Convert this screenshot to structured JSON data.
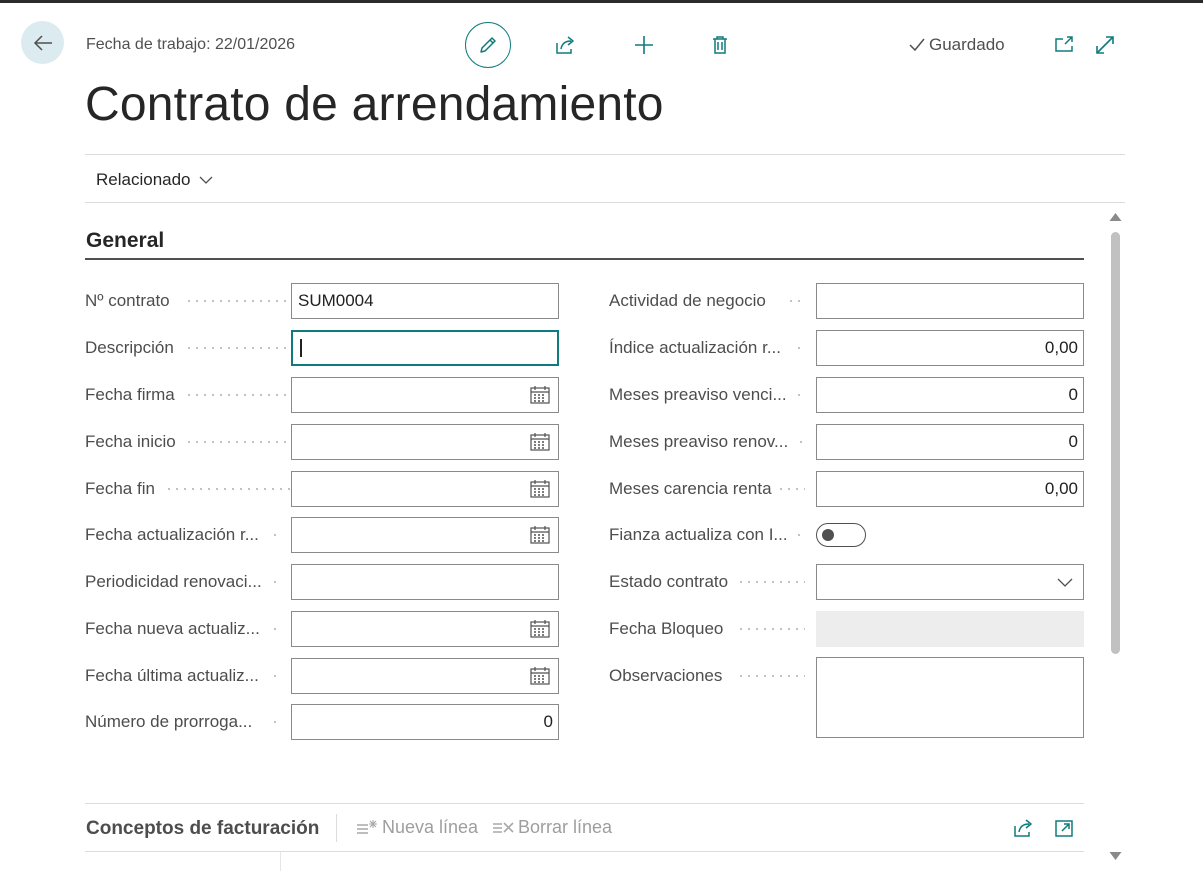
{
  "header": {
    "work_date": "Fecha de trabajo: 22/01/2026",
    "status": "Guardado",
    "title": "Contrato de arrendamiento",
    "related": "Relacionado",
    "icons": [
      "back-arrow-icon",
      "pencil-icon",
      "share-icon",
      "plus-icon",
      "trash-icon",
      "checkmark-icon",
      "popout-icon",
      "expand-icon"
    ]
  },
  "section": {
    "title": "General"
  },
  "left_fields": [
    {
      "label": "Nº contrato",
      "value": "SUM0004",
      "type": "text"
    },
    {
      "label": "Descripción",
      "value": "",
      "type": "text-focused"
    },
    {
      "label": "Fecha firma",
      "value": "",
      "type": "date"
    },
    {
      "label": "Fecha inicio",
      "value": "",
      "type": "date"
    },
    {
      "label": "Fecha fin",
      "value": "",
      "type": "date"
    },
    {
      "label": "Fecha actualización r...",
      "value": "",
      "type": "date"
    },
    {
      "label": "Periodicidad renovaci...",
      "value": "",
      "type": "text"
    },
    {
      "label": "Fecha nueva actualiz...",
      "value": "",
      "type": "date"
    },
    {
      "label": "Fecha última actualiz...",
      "value": "",
      "type": "date"
    },
    {
      "label": "Número de prorroga...",
      "value": "0",
      "type": "number"
    }
  ],
  "right_fields": [
    {
      "label": "Actividad de negocio",
      "value": "",
      "type": "text"
    },
    {
      "label": "Índice actualización r...",
      "value": "0,00",
      "type": "number"
    },
    {
      "label": "Meses preaviso venci...",
      "value": "0",
      "type": "number"
    },
    {
      "label": "Meses preaviso renov...",
      "value": "0",
      "type": "number"
    },
    {
      "label": "Meses carencia renta",
      "value": "0,00",
      "type": "number"
    },
    {
      "label": "Fianza actualiza con I...",
      "value": false,
      "type": "toggle"
    },
    {
      "label": "Estado contrato",
      "value": "",
      "type": "select"
    },
    {
      "label": "Fecha Bloqueo",
      "value": "",
      "type": "disabled"
    },
    {
      "label": "Observaciones",
      "value": "",
      "type": "memo"
    }
  ],
  "subpage": {
    "title": "Conceptos de facturación",
    "new_line": "Nueva línea",
    "delete_line": "Borrar línea"
  },
  "colors": {
    "accent": "#0f7b7d",
    "back_button_bg": "#dcebef",
    "disabled_field": "#ededee"
  }
}
